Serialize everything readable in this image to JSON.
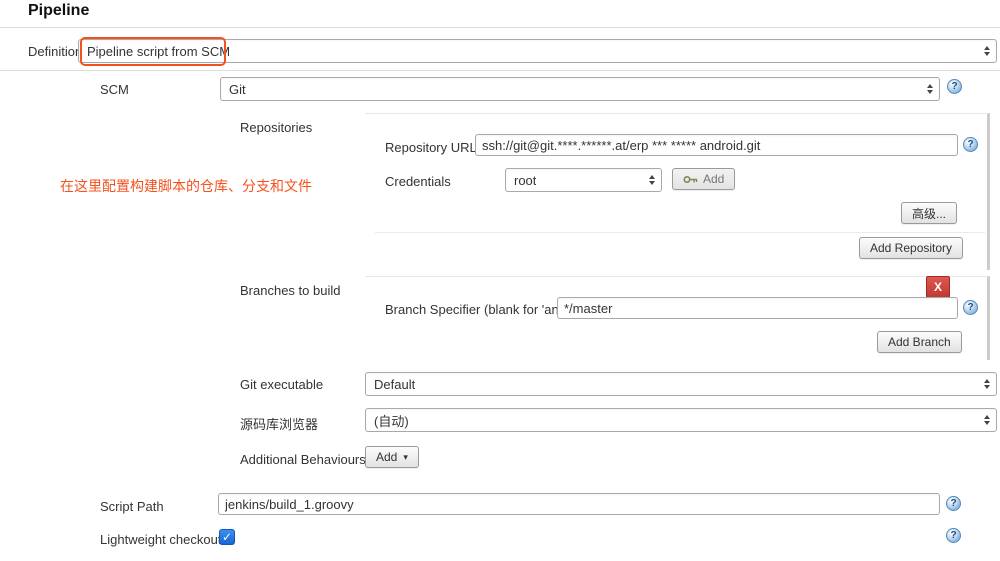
{
  "page": {
    "title": "Pipeline"
  },
  "colors": {
    "annotation_orange": "#f4511e",
    "delete_red": "#c13a32",
    "checkbox_blue": "#1767d2",
    "help_blue": "#6699cc"
  },
  "icons": {
    "help": "?",
    "caret_down": "▾",
    "check": "✓"
  },
  "definition": {
    "label": "Definition",
    "value": "Pipeline script from SCM"
  },
  "scm": {
    "label": "SCM",
    "value": "Git"
  },
  "annotation": {
    "text": "在这里配置构建脚本的仓库、分支和文件"
  },
  "repositories": {
    "section_label": "Repositories",
    "repository_url": {
      "label": "Repository URL",
      "value": "ssh://git@git.****.******.at/erp *** ***** android.git"
    },
    "credentials": {
      "label": "Credentials",
      "value": "root",
      "add_button": "Add"
    },
    "advanced_button": "高级...",
    "add_repository_button": "Add Repository"
  },
  "branches": {
    "section_label": "Branches to build",
    "delete_button": "X",
    "branch_specifier": {
      "label": "Branch Specifier (blank for 'any')",
      "value": "*/master"
    },
    "add_branch_button": "Add Branch"
  },
  "git_executable": {
    "label": "Git executable",
    "value": "Default"
  },
  "repository_browser": {
    "label": "源码库浏览器",
    "value": "(自动)"
  },
  "additional_behaviours": {
    "label": "Additional Behaviours",
    "add_button": "Add"
  },
  "script_path": {
    "label": "Script Path",
    "value": "jenkins/build_1.groovy"
  },
  "lightweight_checkout": {
    "label": "Lightweight checkout",
    "checked": true
  }
}
